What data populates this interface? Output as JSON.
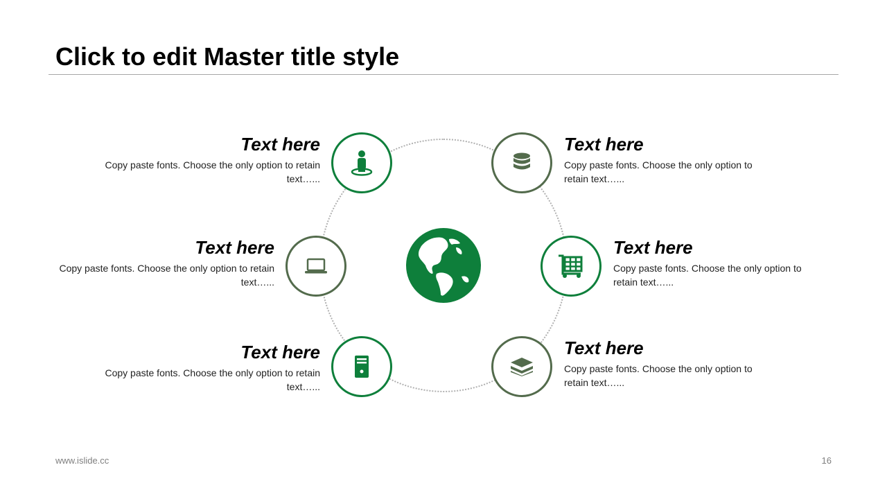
{
  "slide": {
    "title": "Click to edit Master title style",
    "footer_url": "www.islide.cc",
    "page_number": "16"
  },
  "colors": {
    "green": "#0e7f3b",
    "olive": "#536b4c",
    "ring": "#b0b0b0"
  },
  "diagram": {
    "center_icon": "globe-icon",
    "items": [
      {
        "heading": "Text here",
        "body": "Copy paste fonts. Choose the only option to retain text…...",
        "icon": "person-location-icon"
      },
      {
        "heading": "Text here",
        "body": "Copy paste fonts. Choose the only option to retain text…...",
        "icon": "database-icon"
      },
      {
        "heading": "Text here",
        "body": "Copy paste fonts. Choose the only option to retain text…...",
        "icon": "laptop-icon"
      },
      {
        "heading": "Text here",
        "body": "Copy paste fonts. Choose the only option to retain text…...",
        "icon": "shopping-cart-icon"
      },
      {
        "heading": "Text here",
        "body": "Copy paste fonts. Choose the only option to retain text…...",
        "icon": "server-icon"
      },
      {
        "heading": "Text here",
        "body": "Copy paste fonts. Choose the only option to retain text…...",
        "icon": "layers-icon"
      }
    ]
  }
}
